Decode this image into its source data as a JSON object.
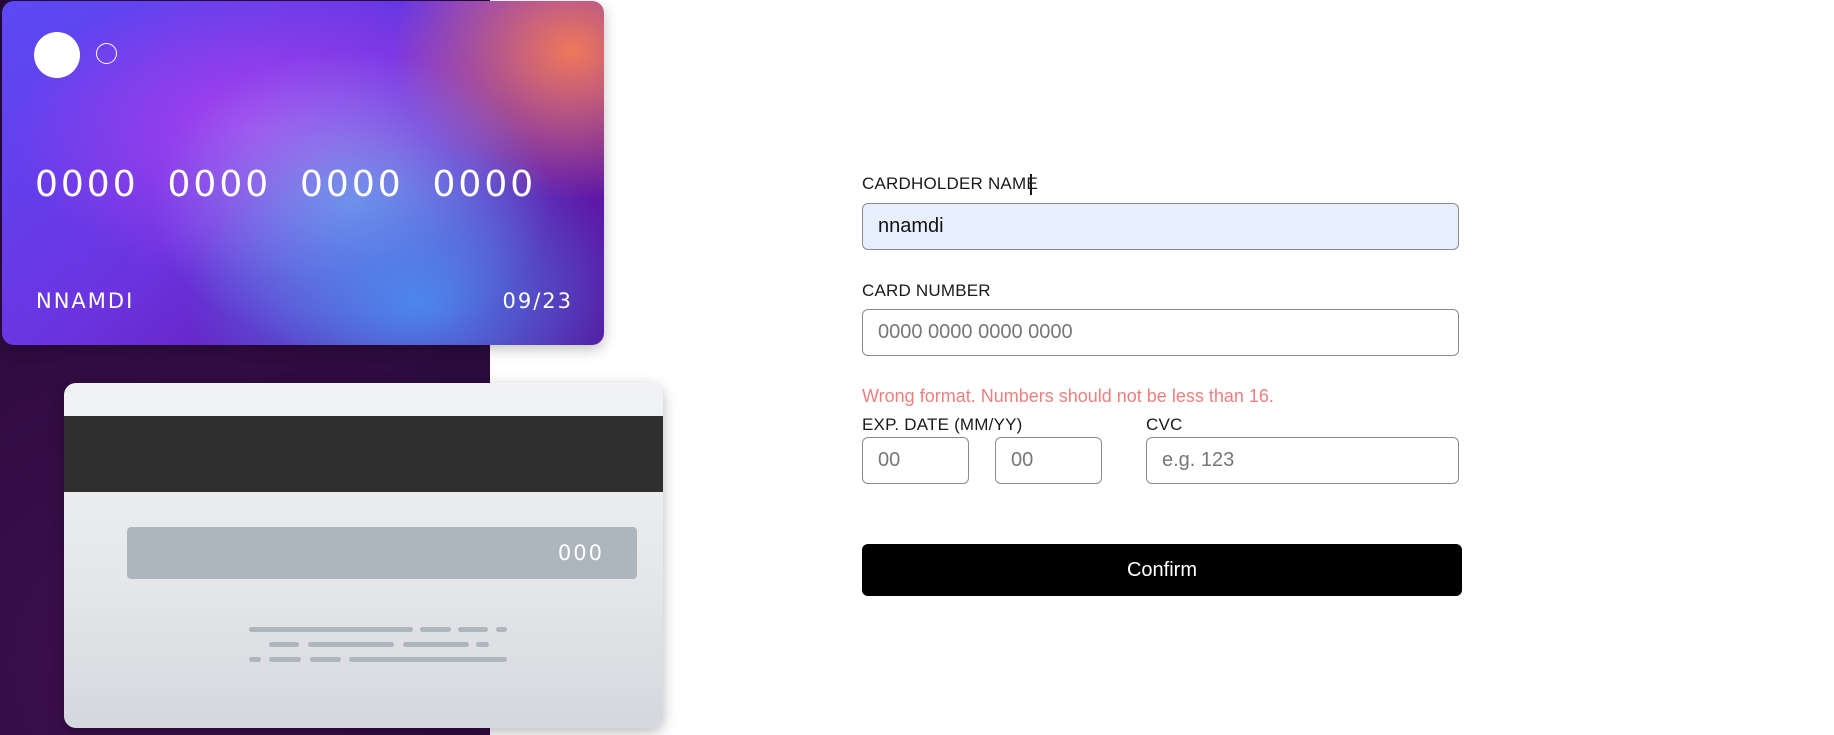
{
  "card_front": {
    "number": "0000  0000  0000  0000",
    "name": "NNAMDI",
    "expiry": "09/23"
  },
  "card_back": {
    "cvc": "000"
  },
  "form": {
    "name_label": "CARDHOLDER NAME",
    "name_value": "nnamdi",
    "number_label": "CARD NUMBER",
    "number_placeholder": "0000 0000 0000 0000",
    "number_error": "Wrong format. Numbers should not be less than 16.",
    "exp_label": "EXP. DATE (MM/YY)",
    "exp_month_placeholder": "00",
    "exp_year_placeholder": "00",
    "cvc_label": "CVC",
    "cvc_placeholder": "e.g. 123",
    "confirm_label": "Confirm"
  }
}
